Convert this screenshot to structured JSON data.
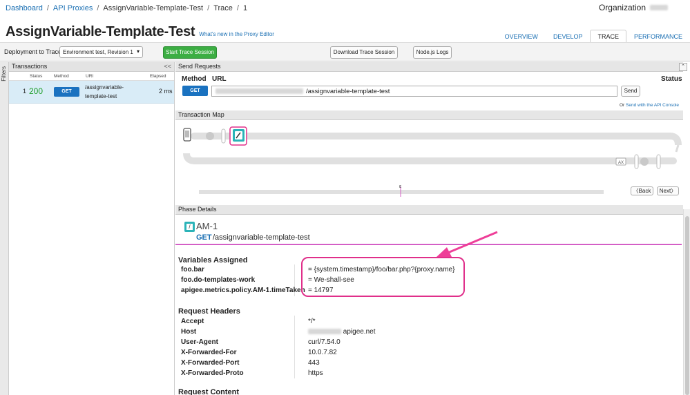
{
  "breadcrumb": {
    "items": [
      "Dashboard",
      "API Proxies",
      "AssignVariable-Template-Test",
      "Trace",
      "1"
    ],
    "separator": "/"
  },
  "org": {
    "label": "Organization"
  },
  "page": {
    "title": "AssignVariable-Template-Test",
    "whats_new": "What's new in the Proxy Editor"
  },
  "tabs": [
    "OVERVIEW",
    "DEVELOP",
    "TRACE",
    "PERFORMANCE"
  ],
  "toolbar": {
    "deploy_label": "Deployment to Trace",
    "env_select": "Environment test, Revision 1",
    "start_button": "Start Trace Session",
    "download_button": "Download Trace Session",
    "nodejs_button": "Node.js Logs"
  },
  "filters": {
    "label": "Filters"
  },
  "transactions": {
    "title": "Transactions",
    "collapse": "<<",
    "columns": [
      "Status",
      "Method",
      "URI",
      "Elapsed"
    ],
    "rows": [
      {
        "index": "1",
        "status": "200",
        "method": "GET",
        "uri_line1": "/assignvariable-",
        "uri_line2": "template-test",
        "elapsed": "2 ms"
      }
    ]
  },
  "send": {
    "title": "Send Requests",
    "method_label": "Method",
    "url_label": "URL",
    "status_label": "Status",
    "method": "GET",
    "url_path": "/assignvariable-template-test",
    "send_button": "Send",
    "console_prefix": "Or",
    "console_link": "Send with the API Console"
  },
  "map": {
    "title": "Transaction Map",
    "ax_label": "AX",
    "back": "Back",
    "next": "Next",
    "timeline_mark": "ε"
  },
  "phase": {
    "title": "Phase Details",
    "policy_name": "AM-1",
    "method": "GET",
    "path": "/assignvariable-template-test"
  },
  "variables": {
    "title": "Variables Assigned",
    "rows": [
      {
        "key": "foo.bar",
        "value": "= {system.timestamp}/foo/bar.php?{proxy.name}"
      },
      {
        "key": "foo.do-templates-work",
        "value": "= We-shall-see"
      },
      {
        "key": "apigee.metrics.policy.AM-1.timeTaken",
        "value": "= 14797"
      }
    ]
  },
  "headers": {
    "title": "Request Headers",
    "rows": [
      {
        "key": "Accept",
        "value": "*/*"
      },
      {
        "key": "Host",
        "value": "apigee.net"
      },
      {
        "key": "User-Agent",
        "value": "curl/7.54.0"
      },
      {
        "key": "X-Forwarded-For",
        "value": "10.0.7.82"
      },
      {
        "key": "X-Forwarded-Port",
        "value": "443"
      },
      {
        "key": "X-Forwarded-Proto",
        "value": "https"
      }
    ]
  },
  "content": {
    "title": "Request Content"
  },
  "colors": {
    "link": "#1a6fb3",
    "status_ok": "#1e9e2a",
    "get_button": "#1a72c0",
    "start_button": "#3cae43",
    "highlight": "#e02f8a",
    "policy_icon": "#2bb3b8"
  }
}
